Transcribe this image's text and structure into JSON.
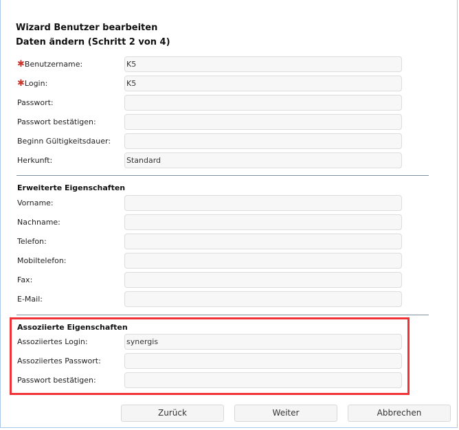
{
  "title": "Wizard Benutzer bearbeiten",
  "subtitle": "Daten ändern (Schritt 2 von 4)",
  "required_mark": "✱",
  "basic": [
    {
      "label": "Benutzername:",
      "value": "K5",
      "required": true
    },
    {
      "label": "Login:",
      "value": "K5",
      "required": true
    },
    {
      "label": "Passwort:",
      "value": ""
    },
    {
      "label": "Passwort bestätigen:",
      "value": ""
    },
    {
      "label": "Beginn Gültigkeitsdauer:",
      "value": ""
    },
    {
      "label": "Herkunft:",
      "value": "Standard"
    }
  ],
  "extended": {
    "heading": "Erweiterte Eigenschaften",
    "fields": [
      {
        "label": "Vorname:",
        "value": ""
      },
      {
        "label": "Nachname:",
        "value": ""
      },
      {
        "label": "Telefon:",
        "value": ""
      },
      {
        "label": "Mobiltelefon:",
        "value": ""
      },
      {
        "label": "Fax:",
        "value": ""
      },
      {
        "label": "E-Mail:",
        "value": ""
      }
    ]
  },
  "associated": {
    "heading": "Assoziierte Eigenschaften",
    "fields": [
      {
        "label": "Assoziiertes Login:",
        "value": "synergis"
      },
      {
        "label": "Assoziiertes Passwort:",
        "value": ""
      },
      {
        "label": "Passwort bestätigen:",
        "value": ""
      }
    ]
  },
  "buttons": {
    "back": "Zurück",
    "next": "Weiter",
    "cancel": "Abbrechen"
  }
}
